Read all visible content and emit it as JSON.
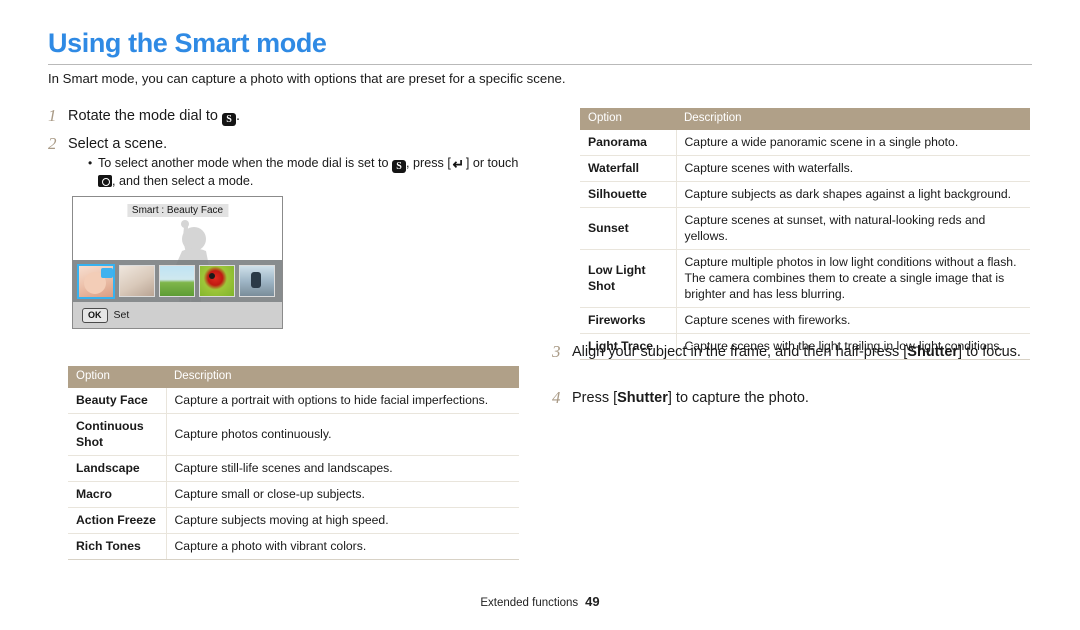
{
  "page": {
    "title": "Using the Smart mode",
    "intro": "In Smart mode, you can capture a photo with options that are preset for a specific scene.",
    "accent_color": "#2f8ae4",
    "table_header_color": "#b0a088",
    "step_number_color": "#a99a86"
  },
  "steps": {
    "step1": {
      "num": "1",
      "text_before": "Rotate the mode dial to ",
      "icon": "smart-mode-icon",
      "text_after": "."
    },
    "step2": {
      "num": "2",
      "text": "Select a scene."
    },
    "bullet": {
      "dot": "•",
      "part1": "To select another mode when the mode dial is set to ",
      "icon1": "smart-mode-icon",
      "part2": ", press [",
      "icon2": "back-arrow-icon",
      "part3": "] or touch ",
      "icon3": "camera-mode-icon",
      "part4": ", and then select a mode."
    },
    "step3": {
      "num": "3",
      "pre": "Align your subject in the frame, and then half-press [",
      "bold": "Shutter",
      "post": "] to focus."
    },
    "step4": {
      "num": "4",
      "pre": "Press [",
      "bold": "Shutter",
      "post": "] to capture the photo."
    }
  },
  "camera_screen": {
    "mode_label": "Smart : Beauty Face",
    "ok_key": "OK",
    "set_label": "Set",
    "thumbnails": [
      {
        "name": "beauty-face-thumbnail",
        "selected": true
      },
      {
        "name": "continuous-shot-thumbnail",
        "selected": false
      },
      {
        "name": "landscape-thumbnail",
        "selected": false
      },
      {
        "name": "macro-thumbnail",
        "selected": false
      },
      {
        "name": "action-freeze-thumbnail",
        "selected": false
      }
    ]
  },
  "table_left": {
    "headers": [
      "Option",
      "Description"
    ],
    "rows": [
      {
        "option": "Beauty Face",
        "description": "Capture a portrait with options to hide facial imperfections."
      },
      {
        "option": "Continuous Shot",
        "description": "Capture photos continuously."
      },
      {
        "option": "Landscape",
        "description": "Capture still-life scenes and landscapes."
      },
      {
        "option": "Macro",
        "description": "Capture small or close-up subjects."
      },
      {
        "option": "Action Freeze",
        "description": "Capture subjects moving at high speed."
      },
      {
        "option": "Rich Tones",
        "description": "Capture a photo with vibrant colors."
      }
    ]
  },
  "table_right": {
    "headers": [
      "Option",
      "Description"
    ],
    "rows": [
      {
        "option": "Panorama",
        "description": "Capture a wide panoramic scene in a single photo."
      },
      {
        "option": "Waterfall",
        "description": "Capture scenes with waterfalls."
      },
      {
        "option": "Silhouette",
        "description": "Capture subjects as dark shapes against a light background."
      },
      {
        "option": "Sunset",
        "description": "Capture scenes at sunset, with natural-looking reds and yellows."
      },
      {
        "option": "Low Light Shot",
        "description": "Capture multiple photos in low light conditions without a flash. The camera combines them to create a single image that is brighter and has less blurring."
      },
      {
        "option": "Fireworks",
        "description": "Capture scenes with fireworks."
      },
      {
        "option": "Light Trace",
        "description": "Capture scenes with the light trailing in low-light conditions."
      }
    ]
  },
  "footer": {
    "section": "Extended functions",
    "page_number": "49"
  }
}
